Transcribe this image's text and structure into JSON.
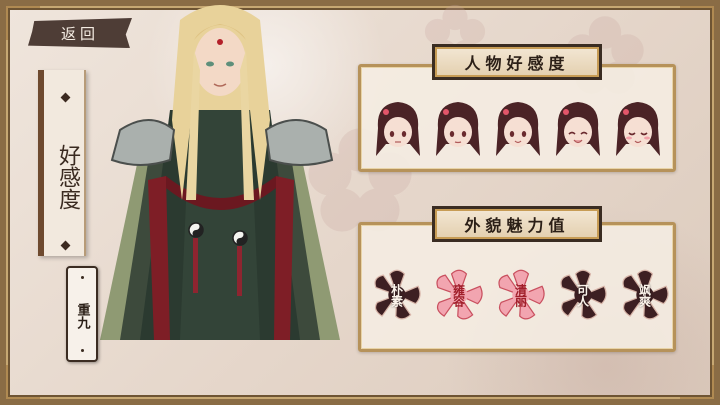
{
  "back_button": {
    "label": "返回"
  },
  "side_banner": {
    "title": "好感度"
  },
  "character": {
    "name": "重九"
  },
  "affection_panel": {
    "title": "人物好感度",
    "faces": [
      {
        "expression": "neutral"
      },
      {
        "expression": "neutral"
      },
      {
        "expression": "neutral"
      },
      {
        "expression": "smile"
      },
      {
        "expression": "happy"
      }
    ]
  },
  "charm_panel": {
    "title": "外貌魅力值",
    "attributes": [
      {
        "label": "朴素",
        "active": false
      },
      {
        "label": "雍容",
        "active": true
      },
      {
        "label": "清丽",
        "active": true
      },
      {
        "label": "可人",
        "active": false
      },
      {
        "label": "飒爽",
        "active": false
      }
    ]
  },
  "colors": {
    "frame": "#8a6c45",
    "flower_dark": "#3d1f22",
    "flower_light": "#f2a5b0",
    "accent_red": "#9e2230"
  }
}
